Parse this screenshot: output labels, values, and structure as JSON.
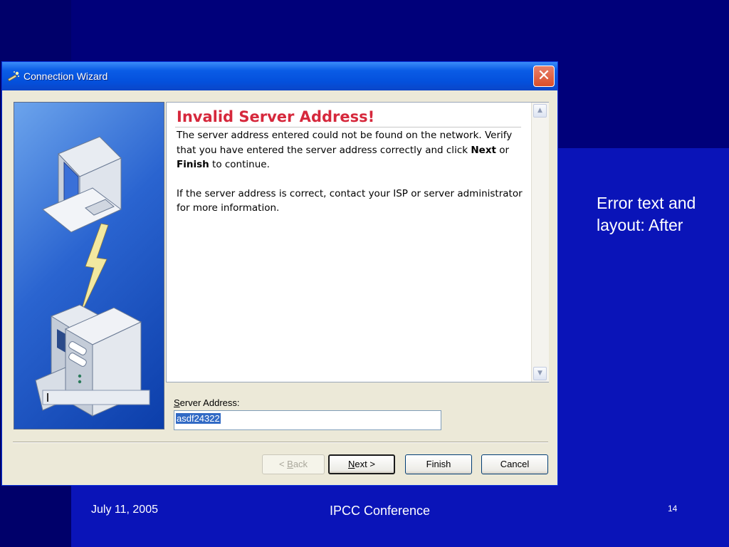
{
  "window": {
    "title": "Connection Wizard",
    "close_glyph": "✕"
  },
  "content": {
    "heading": "Invalid Server Address!",
    "paragraph1_before": "The server address entered could not be found on the network. Verify that you have entered the server address correctly and click ",
    "paragraph1_next": "Next",
    "paragraph1_or": " or ",
    "paragraph1_finish": "Finish",
    "paragraph1_after": " to continue.",
    "paragraph2": "If the server address is correct, contact your ISP or server administrator for more information."
  },
  "form": {
    "label_mnemonic": "S",
    "label_rest": "erver Address:",
    "server_address_value": "asdf24322"
  },
  "buttons": {
    "back_arrow": "< ",
    "back_mnemonic": "B",
    "back_rest": "ack",
    "next_mnemonic": "N",
    "next_rest": "ext >",
    "finish": "Finish",
    "cancel": "Cancel"
  },
  "slide": {
    "note": "Error text and layout: After",
    "date": "July 11, 2005",
    "event": "IPCC Conference",
    "page": "14"
  },
  "icons": {
    "title": "wizard-wand-icon",
    "illustration": "computer-server-connection-icon"
  }
}
